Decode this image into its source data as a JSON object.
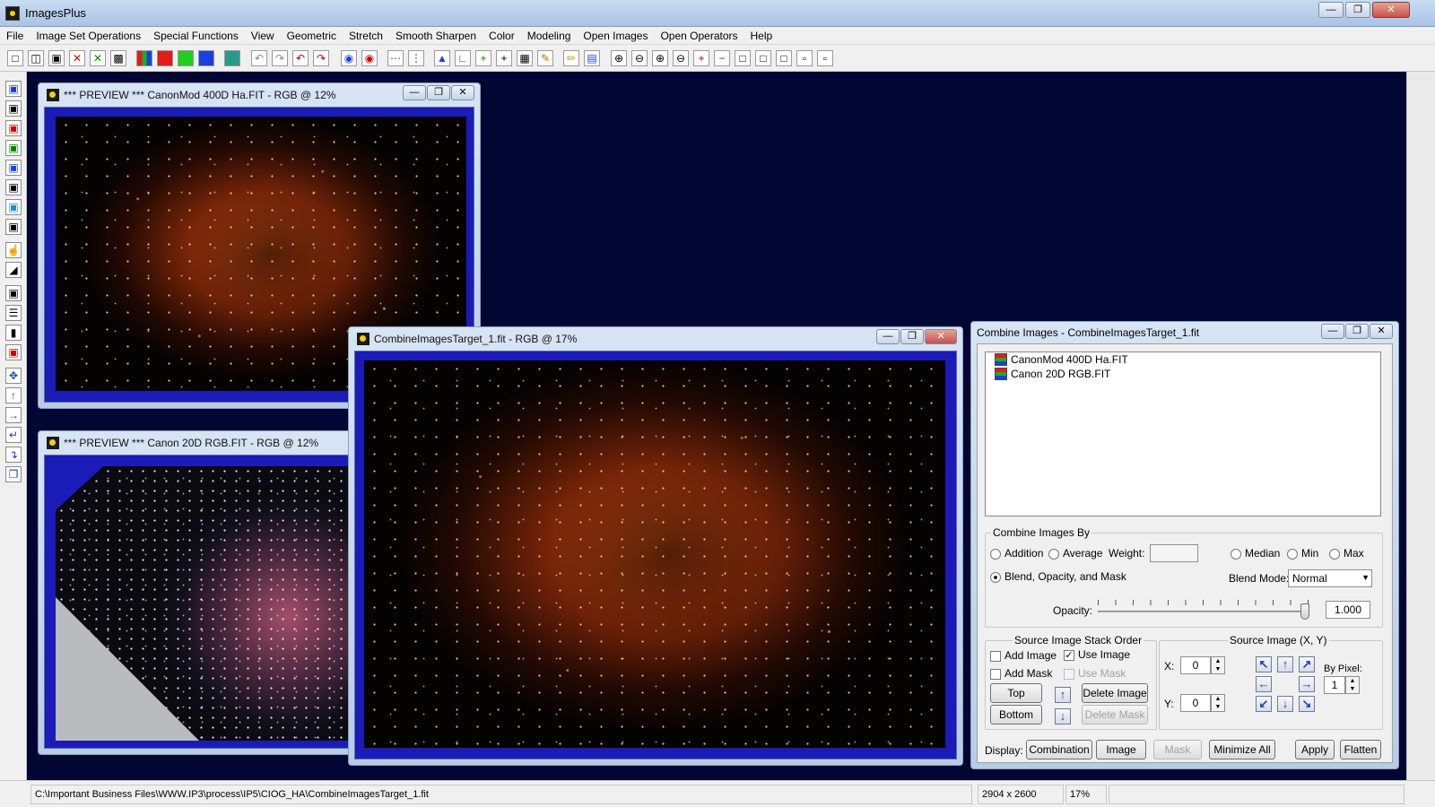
{
  "app": {
    "title": "ImagesPlus"
  },
  "window_controls": {
    "minimize": "—",
    "restore": "❐",
    "close": "✕"
  },
  "menu": [
    "File",
    "Image Set Operations",
    "Special Functions",
    "View",
    "Geometric",
    "Stretch",
    "Smooth Sharpen",
    "Color",
    "Modeling",
    "Open Images",
    "Open Operators",
    "Help"
  ],
  "windows": {
    "preview_ha": {
      "title": "*** PREVIEW *** CanonMod 400D Ha.FIT - RGB @ 12%"
    },
    "preview_rgb": {
      "title": "*** PREVIEW *** Canon 20D RGB.FIT - RGB @ 12%"
    },
    "target": {
      "title": "CombineImagesTarget_1.fit - RGB @ 17%"
    }
  },
  "combine": {
    "title": "Combine Images - CombineImagesTarget_1.fit",
    "images": [
      "CanonMod 400D Ha.FIT",
      "Canon 20D RGB.FIT"
    ],
    "combine_by_label": "Combine Images By",
    "addition": "Addition",
    "average": "Average",
    "weight_label": "Weight:",
    "weight_value": "",
    "median": "Median",
    "min": "Min",
    "max": "Max",
    "blend": "Blend, Opacity, and Mask",
    "blend_mode_label": "Blend Mode:",
    "blend_mode_value": "Normal",
    "opacity_label": "Opacity:",
    "opacity_value": "1.000",
    "opacity_fraction": 1.0,
    "stack_label": "Source Image Stack Order",
    "add_image": "Add Image",
    "use_image": "Use Image",
    "add_mask": "Add Mask",
    "use_mask": "Use Mask",
    "top": "Top",
    "bottom": "Bottom",
    "delete_image": "Delete Image",
    "delete_mask": "Delete Mask",
    "source_label": "Source Image (X, Y)",
    "x_label": "X:",
    "x_value": "0",
    "y_label": "Y:",
    "y_value": "0",
    "by_pixel_label": "By Pixel:",
    "by_pixel_value": "1",
    "display_label": "Display:",
    "combination": "Combination",
    "image": "Image",
    "mask": "Mask",
    "minimize_all": "Minimize All",
    "apply": "Apply",
    "flatten": "Flatten"
  },
  "status": {
    "path": "C:\\Important Business Files\\WWW.IP3\\process\\IP5\\CIOG_HA\\CombineImagesTarget_1.fit",
    "dimensions": "2904 x 2600",
    "zoom": "17%"
  }
}
